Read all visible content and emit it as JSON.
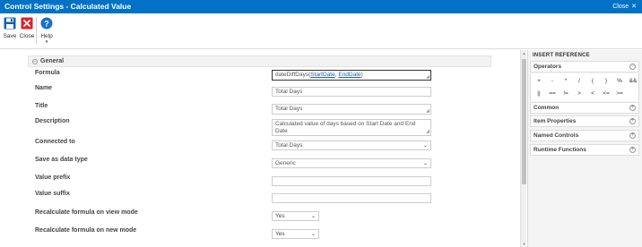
{
  "titlebar": {
    "title": "Control Settings - Calculated Value",
    "close_label": "Close",
    "close_glyph": "✕"
  },
  "ribbon": {
    "save": "Save",
    "close": "Close",
    "help": "Help",
    "help_caret": "▾"
  },
  "section": {
    "title": "General",
    "toggle": "−"
  },
  "form": {
    "formula_label": "Formula",
    "formula_prefix": "dateDiffDays(",
    "formula_arg1": "StartDate",
    "formula_sep": ", ",
    "formula_arg2": "EndDate",
    "formula_suffix": ")",
    "name_label": "Name",
    "name_value": "Total Days",
    "title_label": "Title",
    "title_value": "Total Days",
    "description_label": "Description",
    "description_value": "Calculated value of days based on Start Date and End Date",
    "connected_label": "Connected to",
    "connected_value": "Total Days",
    "savetype_label": "Save as data type",
    "savetype_value": "Generic",
    "prefix_label": "Value prefix",
    "prefix_value": "",
    "suffix_label": "Value suffix",
    "suffix_value": "",
    "recalc_view_label": "Recalculate formula on view mode",
    "recalc_view_value": "Yes",
    "recalc_new_label": "Recalculate formula on new mode",
    "recalc_new_value": "Yes"
  },
  "panel": {
    "title": "INSERT REFERENCE",
    "operators_label": "Operators",
    "operators_toggle": "−",
    "operators_row1": [
      "+",
      "-",
      "*",
      "/",
      "(",
      ")",
      "%",
      "&&"
    ],
    "operators_row2": [
      "||",
      "==",
      "!=",
      ">",
      "<",
      "<=",
      ">="
    ],
    "common_label": "Common",
    "item_properties_label": "Item Properties",
    "named_controls_label": "Named Controls",
    "runtime_functions_label": "Runtime Functions",
    "expand_toggle": "+"
  },
  "colors": {
    "accent": "#0072c6",
    "save_icon": "#1a5fb4",
    "close_icon": "#d9232d",
    "help_icon": "#1a6fc9",
    "link": "#1e5fb4"
  }
}
